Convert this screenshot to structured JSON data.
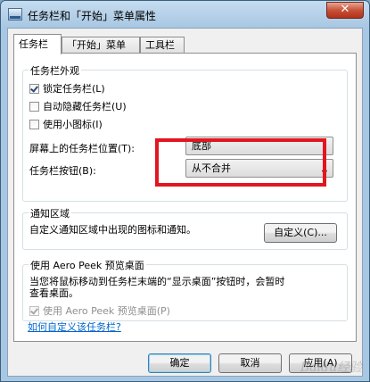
{
  "window": {
    "title": "任务栏和「开始」菜单属性",
    "close_glyph": "✕"
  },
  "tabs": [
    "任务栏",
    "「开始」菜单",
    "工具栏"
  ],
  "appearance": {
    "group_title": "任务栏外观",
    "lock_taskbar": {
      "label": "锁定任务栏(L)",
      "checked": true
    },
    "auto_hide": {
      "label": "自动隐藏任务栏(U)",
      "checked": false
    },
    "small_icons": {
      "label": "使用小图标(I)",
      "checked": false
    },
    "location_label": "屏幕上的任务栏位置(T):",
    "location_value": "底部",
    "buttons_label": "任务栏按钮(B):",
    "buttons_value": "从不合并"
  },
  "notification": {
    "group_title": "通知区域",
    "description": "自定义通知区域中出现的图标和通知。",
    "customize_button": "自定义(C)..."
  },
  "aero_peek": {
    "group_title": "使用 Aero Peek 预览桌面",
    "description_line1": "当您将鼠标移动到任务栏末端的“显示桌面”按钮时，会暂时",
    "description_line2": "查看桌面。",
    "checkbox_label": "使用 Aero Peek 预览桌面(P)"
  },
  "help_link": "如何自定义该任务栏?",
  "buttons": {
    "ok": "确定",
    "cancel": "取消",
    "apply": "应用(A)"
  },
  "watermark": "Baidu经验",
  "colors": {
    "highlight": "#e2161f",
    "link": "#0066cc"
  }
}
